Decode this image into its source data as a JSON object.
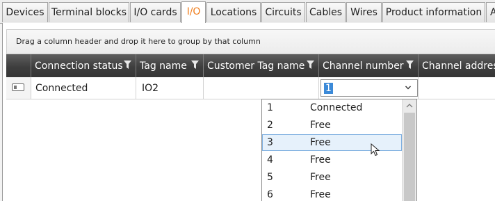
{
  "tabs": [
    {
      "label": "Devices",
      "active": false
    },
    {
      "label": "Terminal blocks",
      "active": false
    },
    {
      "label": "I/O cards",
      "active": false
    },
    {
      "label": "I/O",
      "active": true
    },
    {
      "label": "Locations",
      "active": false
    },
    {
      "label": "Circuits",
      "active": false
    },
    {
      "label": "Cables",
      "active": false
    },
    {
      "label": "Wires",
      "active": false
    },
    {
      "label": "Product information",
      "active": false
    },
    {
      "label": "A",
      "active": false
    }
  ],
  "group_area_text": "Drag a column header and drop it here to group by that column",
  "columns": [
    "Connection status",
    "Tag name",
    "Customer Tag name",
    "Channel number",
    "Channel address"
  ],
  "row": {
    "connection_status": "Connected",
    "tag_name": "IO2",
    "customer_tag_name": "",
    "channel_number": "1"
  },
  "dropdown": {
    "options": [
      {
        "number": "1",
        "status": "Connected"
      },
      {
        "number": "2",
        "status": "Free"
      },
      {
        "number": "3",
        "status": "Free"
      },
      {
        "number": "4",
        "status": "Free"
      },
      {
        "number": "5",
        "status": "Free"
      },
      {
        "number": "6",
        "status": "Free"
      }
    ],
    "highlighted_index": 2
  },
  "colors": {
    "active_tab_text": "#f07c1a",
    "header_background": "#3e3e3e",
    "selection": "#3c8ad8",
    "hover_row": "#e6f1fb"
  },
  "icons": {
    "filter": "funnel-icon",
    "combo_arrow": "chevron-down-icon",
    "row_indicator": "row-edit-icon",
    "scroll_up": "chevron-up-icon",
    "cursor": "mouse-pointer-icon"
  }
}
